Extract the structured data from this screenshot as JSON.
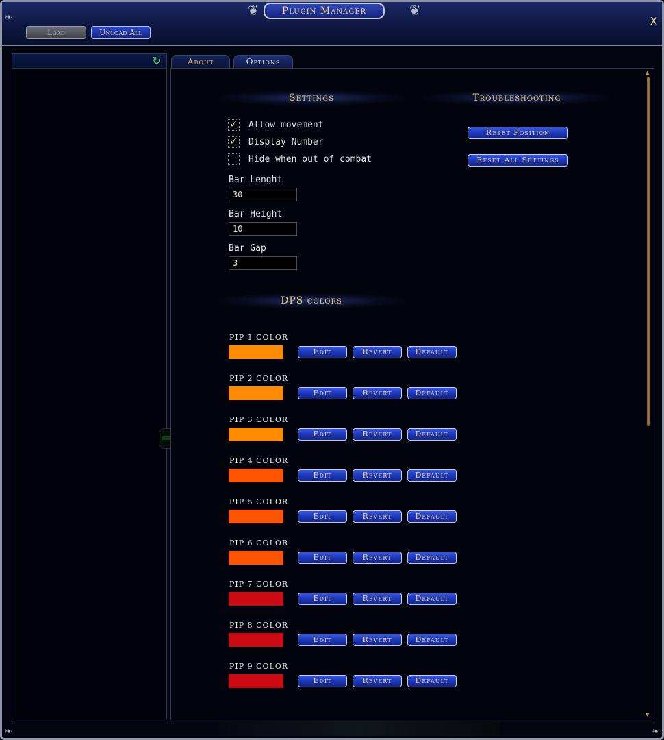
{
  "window": {
    "title": "Plugin Manager",
    "close_label": "X"
  },
  "toolbar": {
    "load_label": "Load",
    "unload_all_label": "Unload All"
  },
  "tabs": [
    {
      "label": "About"
    },
    {
      "label": "Options"
    }
  ],
  "settings": {
    "title": "Settings",
    "checkboxes": [
      {
        "label": "Allow movement",
        "checked": true
      },
      {
        "label": "Display Number",
        "checked": true
      },
      {
        "label": "Hide when out of combat",
        "checked": false
      }
    ],
    "fields": [
      {
        "label": "Bar Lenght",
        "value": "30"
      },
      {
        "label": "Bar Height",
        "value": "10"
      },
      {
        "label": "Bar Gap",
        "value": "3"
      }
    ]
  },
  "troubleshooting": {
    "title": "Troubleshooting",
    "reset_position_label": "Reset Position",
    "reset_all_label": "Reset All Settings"
  },
  "dps_colors": {
    "title": "DPS colors",
    "edit_label": "Edit",
    "revert_label": "Revert",
    "default_label": "Default",
    "pips": [
      {
        "label": "PIP 1 COLOR",
        "color": "#ff8c00"
      },
      {
        "label": "PIP 2 COLOR",
        "color": "#ff8c00"
      },
      {
        "label": "PIP 3 COLOR",
        "color": "#ff8c00"
      },
      {
        "label": "PIP 4 COLOR",
        "color": "#ff5500"
      },
      {
        "label": "PIP 5 COLOR",
        "color": "#ff5500"
      },
      {
        "label": "PIP 6 COLOR",
        "color": "#ff5500"
      },
      {
        "label": "PIP 7 COLOR",
        "color": "#cc0a14"
      },
      {
        "label": "PIP 8 COLOR",
        "color": "#cc0a14"
      },
      {
        "label": "PIP 9 COLOR",
        "color": "#cc0a14"
      }
    ]
  },
  "icons": {
    "refresh": "refresh-icon",
    "close": "close-icon"
  }
}
